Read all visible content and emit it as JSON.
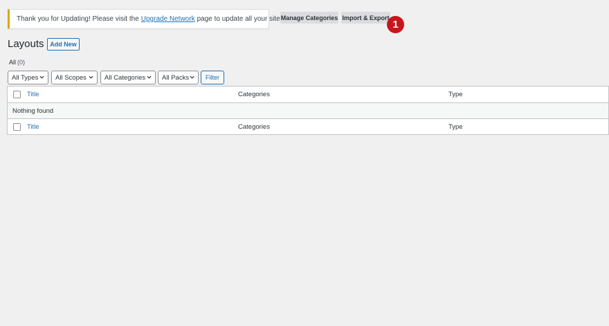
{
  "notice": {
    "text_before": "Thank you for Updating! Please visit the",
    "link": "Upgrade Network",
    "text_after": "page to update all your sites."
  },
  "toolbar": {
    "manage_categories": "Manage Categories",
    "import_export": "Import & Export"
  },
  "annotation": {
    "step": "1",
    "color": "#c8161d"
  },
  "header": {
    "title": "Layouts",
    "add_new": "Add New"
  },
  "views": {
    "all_label": "All",
    "all_count": "(0)"
  },
  "filters": {
    "types": "All Types",
    "scopes": "All Scopes",
    "categories": "All Categories",
    "packs": "All Packs",
    "filter_button": "Filter"
  },
  "table": {
    "columns": [
      "Title",
      "Categories",
      "Type"
    ],
    "empty_message": "Nothing found"
  },
  "colors": {
    "link": "#2271b1",
    "notice_border": "#dba617",
    "background": "#f0f0f1"
  }
}
